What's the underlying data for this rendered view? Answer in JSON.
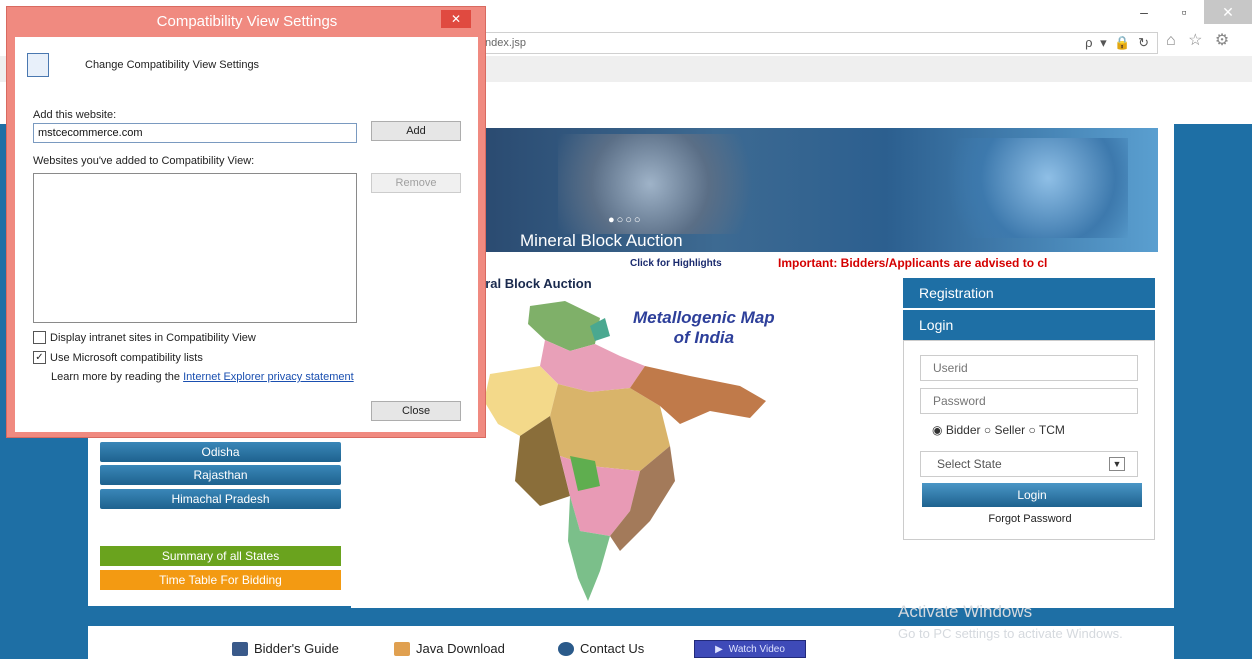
{
  "browser": {
    "address_text": "ndex.jsp",
    "address_icons": "ρ ▾ 🔒 ↻",
    "tool_icons": "⌂ ☆ ⚙",
    "minimize": "–",
    "restore": "▫",
    "close": "✕"
  },
  "banner": {
    "dots": "●○○○",
    "title": "Mineral Block Auction",
    "click_text": "Click for Highlights",
    "important_text": "Important: Bidders/Applicants are advised to cl"
  },
  "section": {
    "title": "eral Block Auction"
  },
  "map": {
    "title_line1": "Metallogenic Map",
    "title_line2": "of India"
  },
  "states": [
    {
      "label": "Odisha"
    },
    {
      "label": "Rajasthan"
    },
    {
      "label": "Himachal Pradesh"
    }
  ],
  "summary_label": "Summary of all States",
  "timetable_label": "Time Table For Bidding",
  "panel": {
    "registration": "Registration",
    "login_header": "Login",
    "userid_placeholder": "Userid",
    "password_placeholder": "Password",
    "radio_bidder": "Bidder",
    "radio_seller": "Seller",
    "radio_tcm": "TCM",
    "select_state": "Select State",
    "login_button": "Login",
    "forgot": "Forgot Password"
  },
  "footer": {
    "bidders_guide": "Bidder's Guide",
    "java_download": "Java Download",
    "contact_us": "Contact Us",
    "watch_video": "Watch Video"
  },
  "watermark": {
    "line1": "Activate Windows",
    "line2": "Go to PC settings to activate Windows."
  },
  "dialog": {
    "title": "Compatibility View Settings",
    "close": "✕",
    "heading": "Change Compatibility View Settings",
    "add_label": "Add this website:",
    "add_value": "mstcecommerce.com",
    "add_button": "Add",
    "list_label": "Websites you've added to Compatibility View:",
    "remove_button": "Remove",
    "chk_intranet": "Display intranet sites in Compatibility View",
    "chk_mslists": "Use Microsoft compatibility lists",
    "learn_prefix": "Learn more by reading the",
    "learn_link": "Internet Explorer privacy statement",
    "close_button": "Close"
  },
  "colors": {
    "page_blue": "#1e6fa5",
    "dialog_border": "#f08a80",
    "important_red": "#d40000",
    "summary_green": "#6aa31e",
    "timetable_orange": "#f39a12"
  }
}
